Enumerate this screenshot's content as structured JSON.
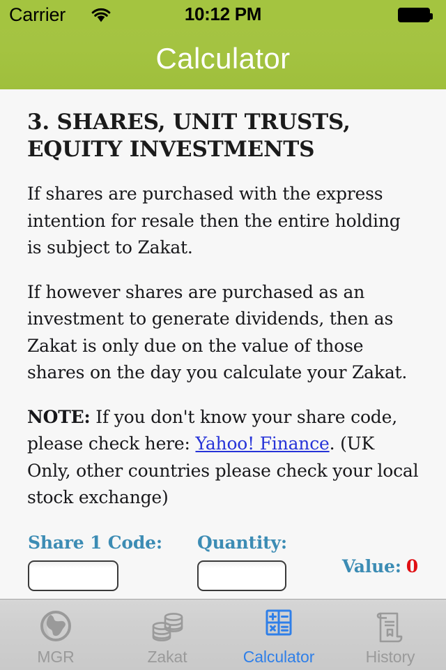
{
  "statusbar": {
    "carrier": "Carrier",
    "time": "10:12 PM",
    "wifi_icon": "wifi-icon",
    "battery_icon": "battery-full-icon"
  },
  "navbar": {
    "title": "Calculator",
    "background_color": "#a4c440"
  },
  "content": {
    "heading": "3. SHARES, UNIT TRUSTS, EQUITY INVESTMENTS",
    "paragraph_1": "If shares are purchased with the express intention for resale then the entire holding is subject to Zakat.",
    "paragraph_2": "If however shares are purchased as an investment to generate dividends, then as Zakat is only due on the value of those shares on the day you calculate your Zakat.",
    "note_label": "NOTE:",
    "note_before_link": " If you don't know your share code, please check here: ",
    "note_link_text": "Yahoo! Finance",
    "note_after_link": ". (UK Only, other countries please check your local stock exchange)",
    "link_color": "#2633d8"
  },
  "form": {
    "share_label": "Share 1 Code:",
    "share_value": "",
    "share_placeholder": "",
    "quantity_label": "Quantity:",
    "quantity_value": "",
    "quantity_placeholder": "",
    "value_label": "Value:",
    "value_amount": "0",
    "value_amount_color": "#e00f14",
    "label_color": "#3c8cb4",
    "second_field_value": "",
    "second_field_placeholder": ""
  },
  "tabbar": {
    "tabs": [
      {
        "label": "MGR",
        "icon": "globe-icon",
        "active": false
      },
      {
        "label": "Zakat",
        "icon": "coins-icon",
        "active": false
      },
      {
        "label": "Calculator",
        "icon": "calculator-icon",
        "active": true
      },
      {
        "label": "History",
        "icon": "scroll-document-icon",
        "active": false
      }
    ],
    "active_color": "#2f7fe8",
    "inactive_color": "#9a9a9a"
  }
}
